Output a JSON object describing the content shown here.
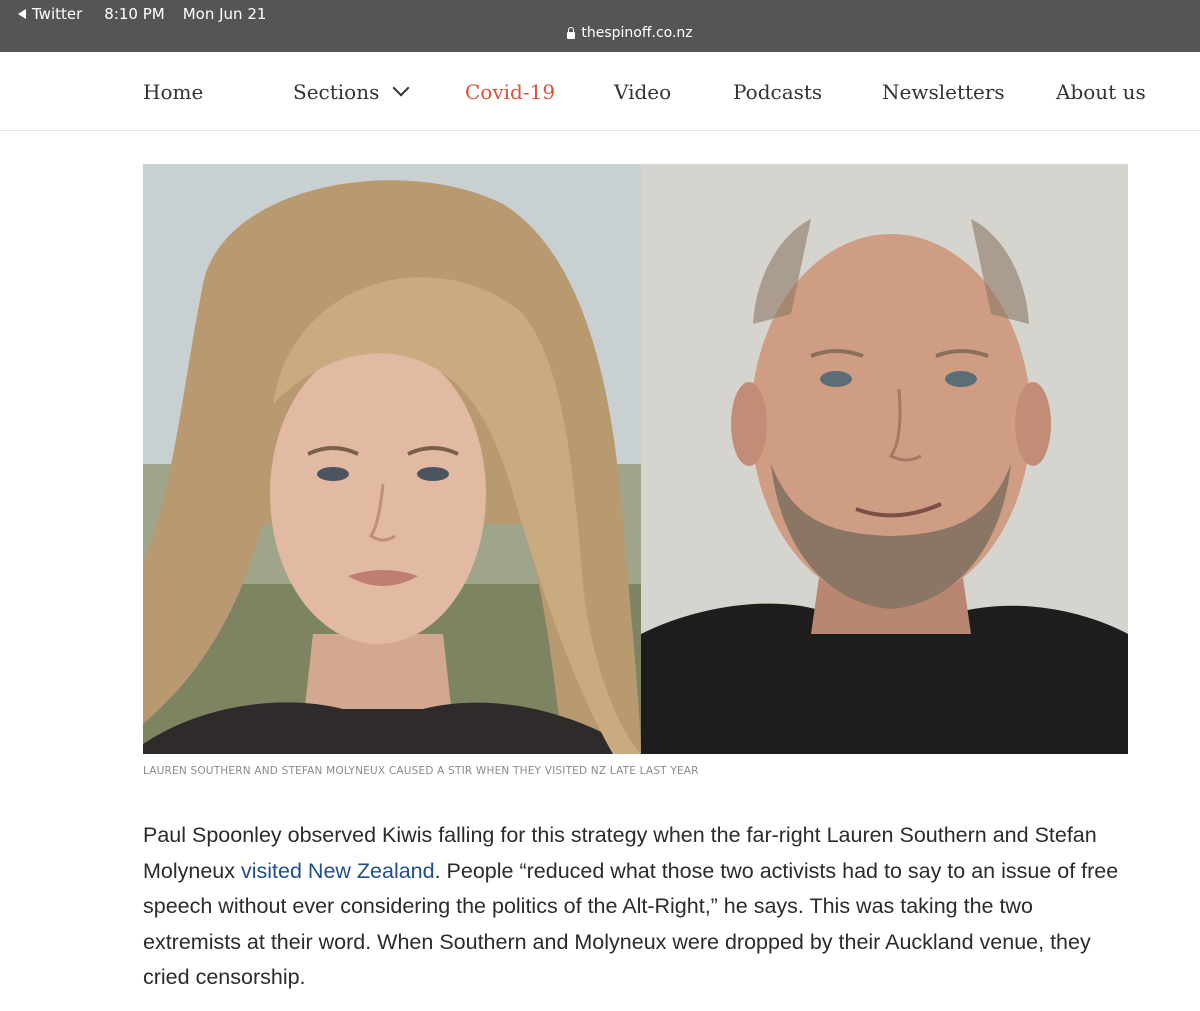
{
  "status_bar": {
    "back_app": "Twitter",
    "time": "8:10 PM",
    "date": "Mon Jun 21",
    "url": "thespinoff.co.nz",
    "lock_icon": "lock-icon",
    "back_icon": "back-triangle-icon"
  },
  "nav": {
    "items": [
      {
        "label": "Home"
      },
      {
        "label": "Sections"
      },
      {
        "label": "Covid-19"
      },
      {
        "label": "Video"
      },
      {
        "label": "Podcasts"
      },
      {
        "label": "Newsletters"
      },
      {
        "label": "About us"
      }
    ],
    "accent_color": "#d9513a"
  },
  "article": {
    "caption": "LAUREN SOUTHERN AND STEFAN MOLYNEUX CAUSED A STIR WHEN THEY VISITED NZ LATE LAST YEAR",
    "paragraph_before_link": "Paul Spoonley observed Kiwis falling for this strategy when the far-right Lauren Southern and Stefan Molyneux ",
    "link_text": "visited New Zealand",
    "paragraph_after_link": ". People “reduced what those two activists had to say to an issue of free speech without ever considering the politics of the Alt-Right,” he says. This was taking the two extremists at their word. When Southern and Molyneux were dropped by their Auckland venue, they cried censorship.",
    "link_color": "#1f4e8c"
  }
}
